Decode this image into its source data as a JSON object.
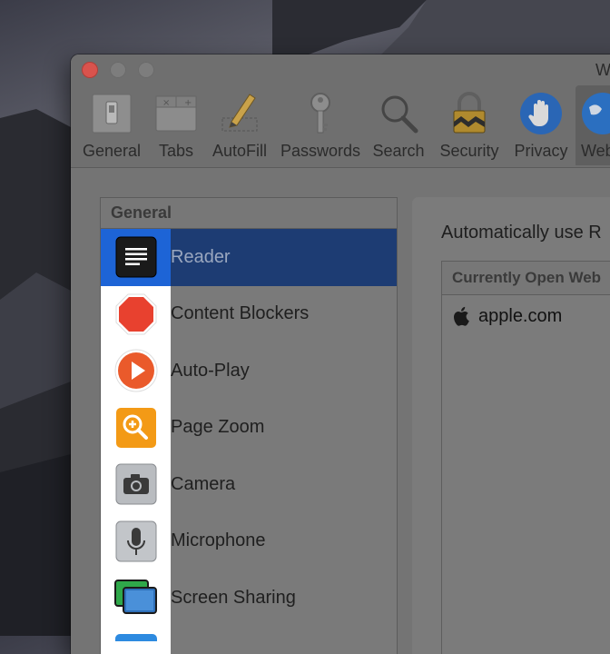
{
  "window": {
    "title": "W"
  },
  "toolbar": {
    "items": [
      {
        "label": "General",
        "icon": "general-icon"
      },
      {
        "label": "Tabs",
        "icon": "tabs-icon"
      },
      {
        "label": "AutoFill",
        "icon": "autofill-pencil-icon"
      },
      {
        "label": "Passwords",
        "icon": "key-icon"
      },
      {
        "label": "Search",
        "icon": "magnifier-icon"
      },
      {
        "label": "Security",
        "icon": "lock-icon"
      },
      {
        "label": "Privacy",
        "icon": "hand-icon"
      },
      {
        "label": "Web",
        "icon": "globe-icon",
        "active": true
      }
    ]
  },
  "sidebar": {
    "header": "General",
    "items": [
      {
        "label": "Reader",
        "icon": "reader-icon",
        "selected": true
      },
      {
        "label": "Content Blockers",
        "icon": "stop-sign-icon"
      },
      {
        "label": "Auto-Play",
        "icon": "play-icon"
      },
      {
        "label": "Page Zoom",
        "icon": "zoom-icon"
      },
      {
        "label": "Camera",
        "icon": "camera-icon"
      },
      {
        "label": "Microphone",
        "icon": "microphone-icon"
      },
      {
        "label": "Screen Sharing",
        "icon": "screen-sharing-icon"
      }
    ]
  },
  "main": {
    "auto_text": "Automatically use R",
    "sites_header": "Currently Open Web",
    "sites": [
      {
        "label": "apple.com",
        "icon": "apple-logo-icon"
      }
    ]
  },
  "colors": {
    "selection": "#1d3c73",
    "selection_icon_cell": "#1d64d6",
    "close_button": "#d9534d"
  }
}
